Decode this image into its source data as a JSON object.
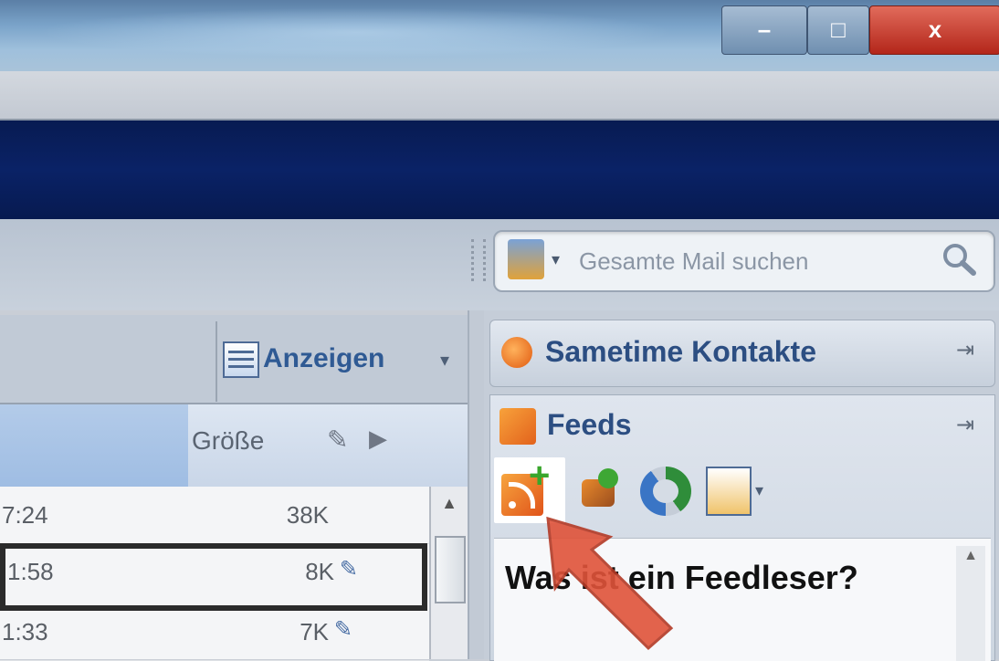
{
  "window": {
    "minimize_glyph": "–",
    "maximize_glyph": "□",
    "close_glyph": "x"
  },
  "search": {
    "placeholder": "Gesamte Mail suchen",
    "scope_icon": "mail-scope-icon",
    "icon": "search-icon"
  },
  "list_toolbar": {
    "view_label": "Anzeigen",
    "view_arrow": "▾"
  },
  "columns": {
    "size_label": "Größe",
    "clip_glyph": "✎",
    "flag_glyph": "▶"
  },
  "rows": [
    {
      "time": "7:24",
      "size": "38K",
      "attachment": ""
    },
    {
      "time": "1:58",
      "size": "8K",
      "attachment": "✎"
    },
    {
      "time": "1:33",
      "size": "7K",
      "attachment": "✎"
    }
  ],
  "sidebar": {
    "sametime": {
      "label": "Sametime Kontakte",
      "pin": "⇥"
    },
    "feeds": {
      "label": "Feeds",
      "pin": "⇥",
      "toolbar_arrow": "▾",
      "heading": "Was ist ein Feedleser?",
      "scroll_up": "▲"
    }
  },
  "colors": {
    "navy_band": "#0a2266",
    "close_button": "#c8321f",
    "callout_arrow": "#e0533a",
    "link_blue": "#2c4e82"
  }
}
